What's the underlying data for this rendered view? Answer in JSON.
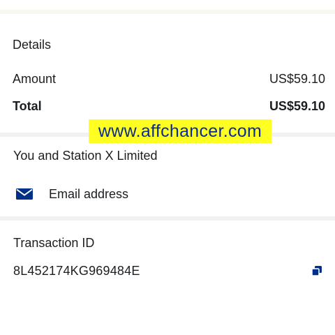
{
  "details": {
    "title": "Details",
    "amount_label": "Amount",
    "amount_value": "US$59.10",
    "total_label": "Total",
    "total_value": "US$59.10"
  },
  "watermark": "www.affchancer.com",
  "merchant": {
    "party": "You and Station X Limited",
    "email_icon": "envelope-icon",
    "email_label": "Email address"
  },
  "transaction": {
    "title": "Transaction ID",
    "id": "8L452174KG969484E",
    "copy_icon": "copy-icon"
  },
  "colors": {
    "brand_blue": "#0b2d8f",
    "icon_blue": "#003087",
    "watermark_bg": "#ffff22",
    "text": "#1b1e21",
    "divider": "#f0f1f2"
  }
}
